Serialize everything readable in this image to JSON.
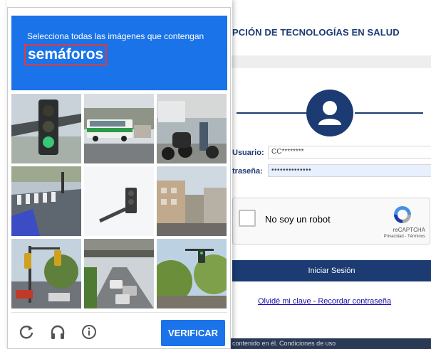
{
  "background_page": {
    "header_title": "PCIÓN DE TECNOLOGÍAS EN SALUD",
    "usuario_label": "Usuario:",
    "usuario_value": "CC********",
    "password_label": "traseña:",
    "password_value": "••••••••••••••",
    "recaptcha": {
      "checkbox_label": "No soy un robot",
      "brand": "reCAPTCHA",
      "privacy": "Privacidad - Términos"
    },
    "login_button": "Iniciar Sesión",
    "forgot_link": "Olvidé mi clave - Recordar contraseña",
    "footer_text": "contenido en él. Condiciones de uso"
  },
  "captcha": {
    "instruction": "Selecciona todas las imágenes que contengan",
    "target": "semáforos",
    "verify_button": "VERIFICAR",
    "tiles": [
      {
        "name": "traffic-light-closeup"
      },
      {
        "name": "bus-on-street"
      },
      {
        "name": "motorcycles-parked"
      },
      {
        "name": "crosswalk-street"
      },
      {
        "name": "traffic-light-sky"
      },
      {
        "name": "city-road-buildings"
      },
      {
        "name": "intersection-traffic-lights"
      },
      {
        "name": "overpass-cars"
      },
      {
        "name": "trees-traffic-light"
      }
    ],
    "tools": [
      "reload-icon",
      "audio-icon",
      "info-icon"
    ]
  },
  "colors": {
    "captcha_blue": "#1a73e8",
    "site_navy": "#1b3b72",
    "highlight_red": "#e53935"
  }
}
